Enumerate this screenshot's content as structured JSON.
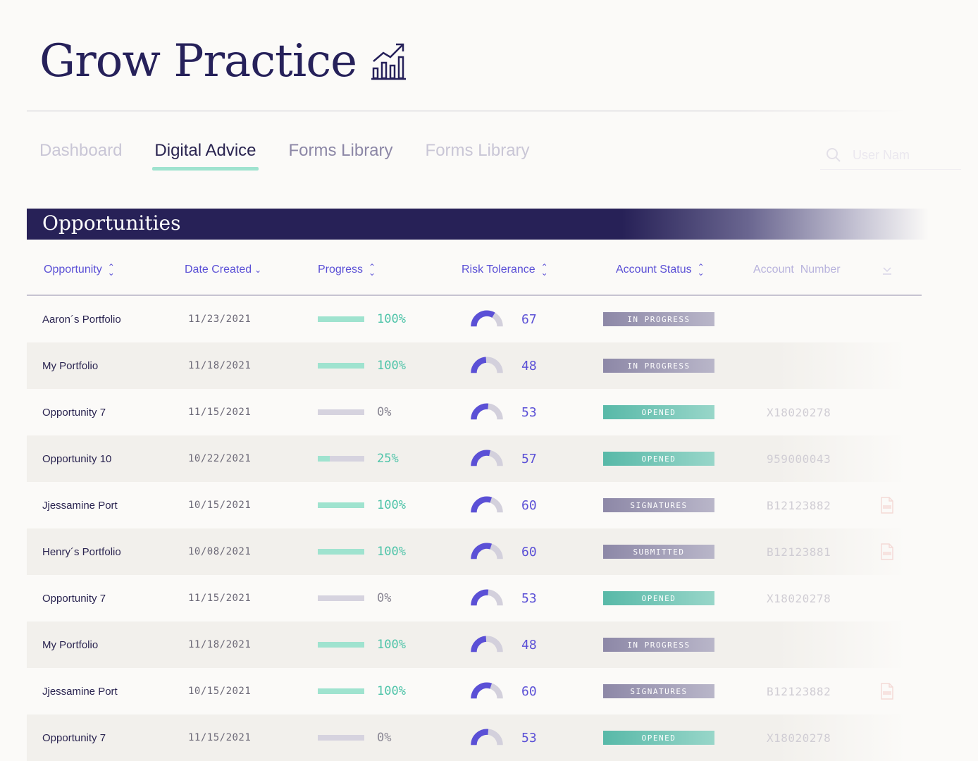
{
  "app": {
    "title": "Grow Practice",
    "title_icon": "bar-chart-growth-icon"
  },
  "tabs": [
    {
      "label": "Dashboard",
      "state": "inactive"
    },
    {
      "label": "Digital Advice",
      "state": "active"
    },
    {
      "label": "Forms Library",
      "state": "inactive"
    },
    {
      "label": "Forms Library",
      "state": "faded"
    }
  ],
  "search": {
    "placeholder": "User Nam",
    "icon": "search-icon"
  },
  "section": {
    "title": "Opportunities"
  },
  "columns": [
    {
      "label": "Opportunity",
      "sort": "both"
    },
    {
      "label": "Date Created",
      "sort": "down"
    },
    {
      "label": "Progress",
      "sort": "both"
    },
    {
      "label": "Risk Tolerance",
      "sort": "both"
    },
    {
      "label": "Account Status",
      "sort": "both"
    },
    {
      "label": "Account  Number",
      "sort": "none"
    }
  ],
  "rows": [
    {
      "name": "Aaron´s Portfolio",
      "date": "11/23/2021",
      "progress": 100,
      "progress_label": "100%",
      "risk": 67,
      "risk_label": "67",
      "status": "IN PROGRESS",
      "status_color": "gray",
      "account": "",
      "doc": false
    },
    {
      "name": "My Portfolio",
      "date": "11/18/2021",
      "progress": 100,
      "progress_label": "100%",
      "risk": 48,
      "risk_label": "48",
      "status": "IN PROGRESS",
      "status_color": "gray",
      "account": "",
      "doc": false
    },
    {
      "name": "Opportunity 7",
      "date": "11/15/2021",
      "progress": 0,
      "progress_label": "0%",
      "risk": 53,
      "risk_label": "53",
      "status": "OPENED",
      "status_color": "teal",
      "account": "X18020278",
      "doc": false
    },
    {
      "name": "Opportunity 10",
      "date": "10/22/2021",
      "progress": 25,
      "progress_label": "25%",
      "risk": 57,
      "risk_label": "57",
      "status": "OPENED",
      "status_color": "teal",
      "account": "959000043",
      "doc": false
    },
    {
      "name": "Jjessamine Port",
      "date": "10/15/2021",
      "progress": 100,
      "progress_label": "100%",
      "risk": 60,
      "risk_label": "60",
      "status": "SIGNATURES",
      "status_color": "gray",
      "account": "B12123882",
      "doc": true
    },
    {
      "name": "Henry´s Portfolio",
      "date": "10/08/2021",
      "progress": 100,
      "progress_label": "100%",
      "risk": 60,
      "risk_label": "60",
      "status": "SUBMITTED",
      "status_color": "gray",
      "account": "B12123881",
      "doc": true
    },
    {
      "name": "Opportunity 7",
      "date": "11/15/2021",
      "progress": 0,
      "progress_label": "0%",
      "risk": 53,
      "risk_label": "53",
      "status": "OPENED",
      "status_color": "teal",
      "account": "X18020278",
      "doc": false
    },
    {
      "name": "My Portfolio",
      "date": "11/18/2021",
      "progress": 100,
      "progress_label": "100%",
      "risk": 48,
      "risk_label": "48",
      "status": "IN PROGRESS",
      "status_color": "gray",
      "account": "",
      "doc": false
    },
    {
      "name": "Jjessamine Port",
      "date": "10/15/2021",
      "progress": 100,
      "progress_label": "100%",
      "risk": 60,
      "risk_label": "60",
      "status": "SIGNATURES",
      "status_color": "gray",
      "account": "B12123882",
      "doc": true
    },
    {
      "name": "Opportunity 7",
      "date": "11/15/2021",
      "progress": 0,
      "progress_label": "0%",
      "risk": 53,
      "risk_label": "53",
      "status": "OPENED",
      "status_color": "teal",
      "account": "X18020278",
      "doc": false
    }
  ],
  "colors": {
    "navy": "#272157",
    "accent_purple": "#5b50d6",
    "mint": "#9fe3cf",
    "teal_text": "#4fc4a9"
  }
}
